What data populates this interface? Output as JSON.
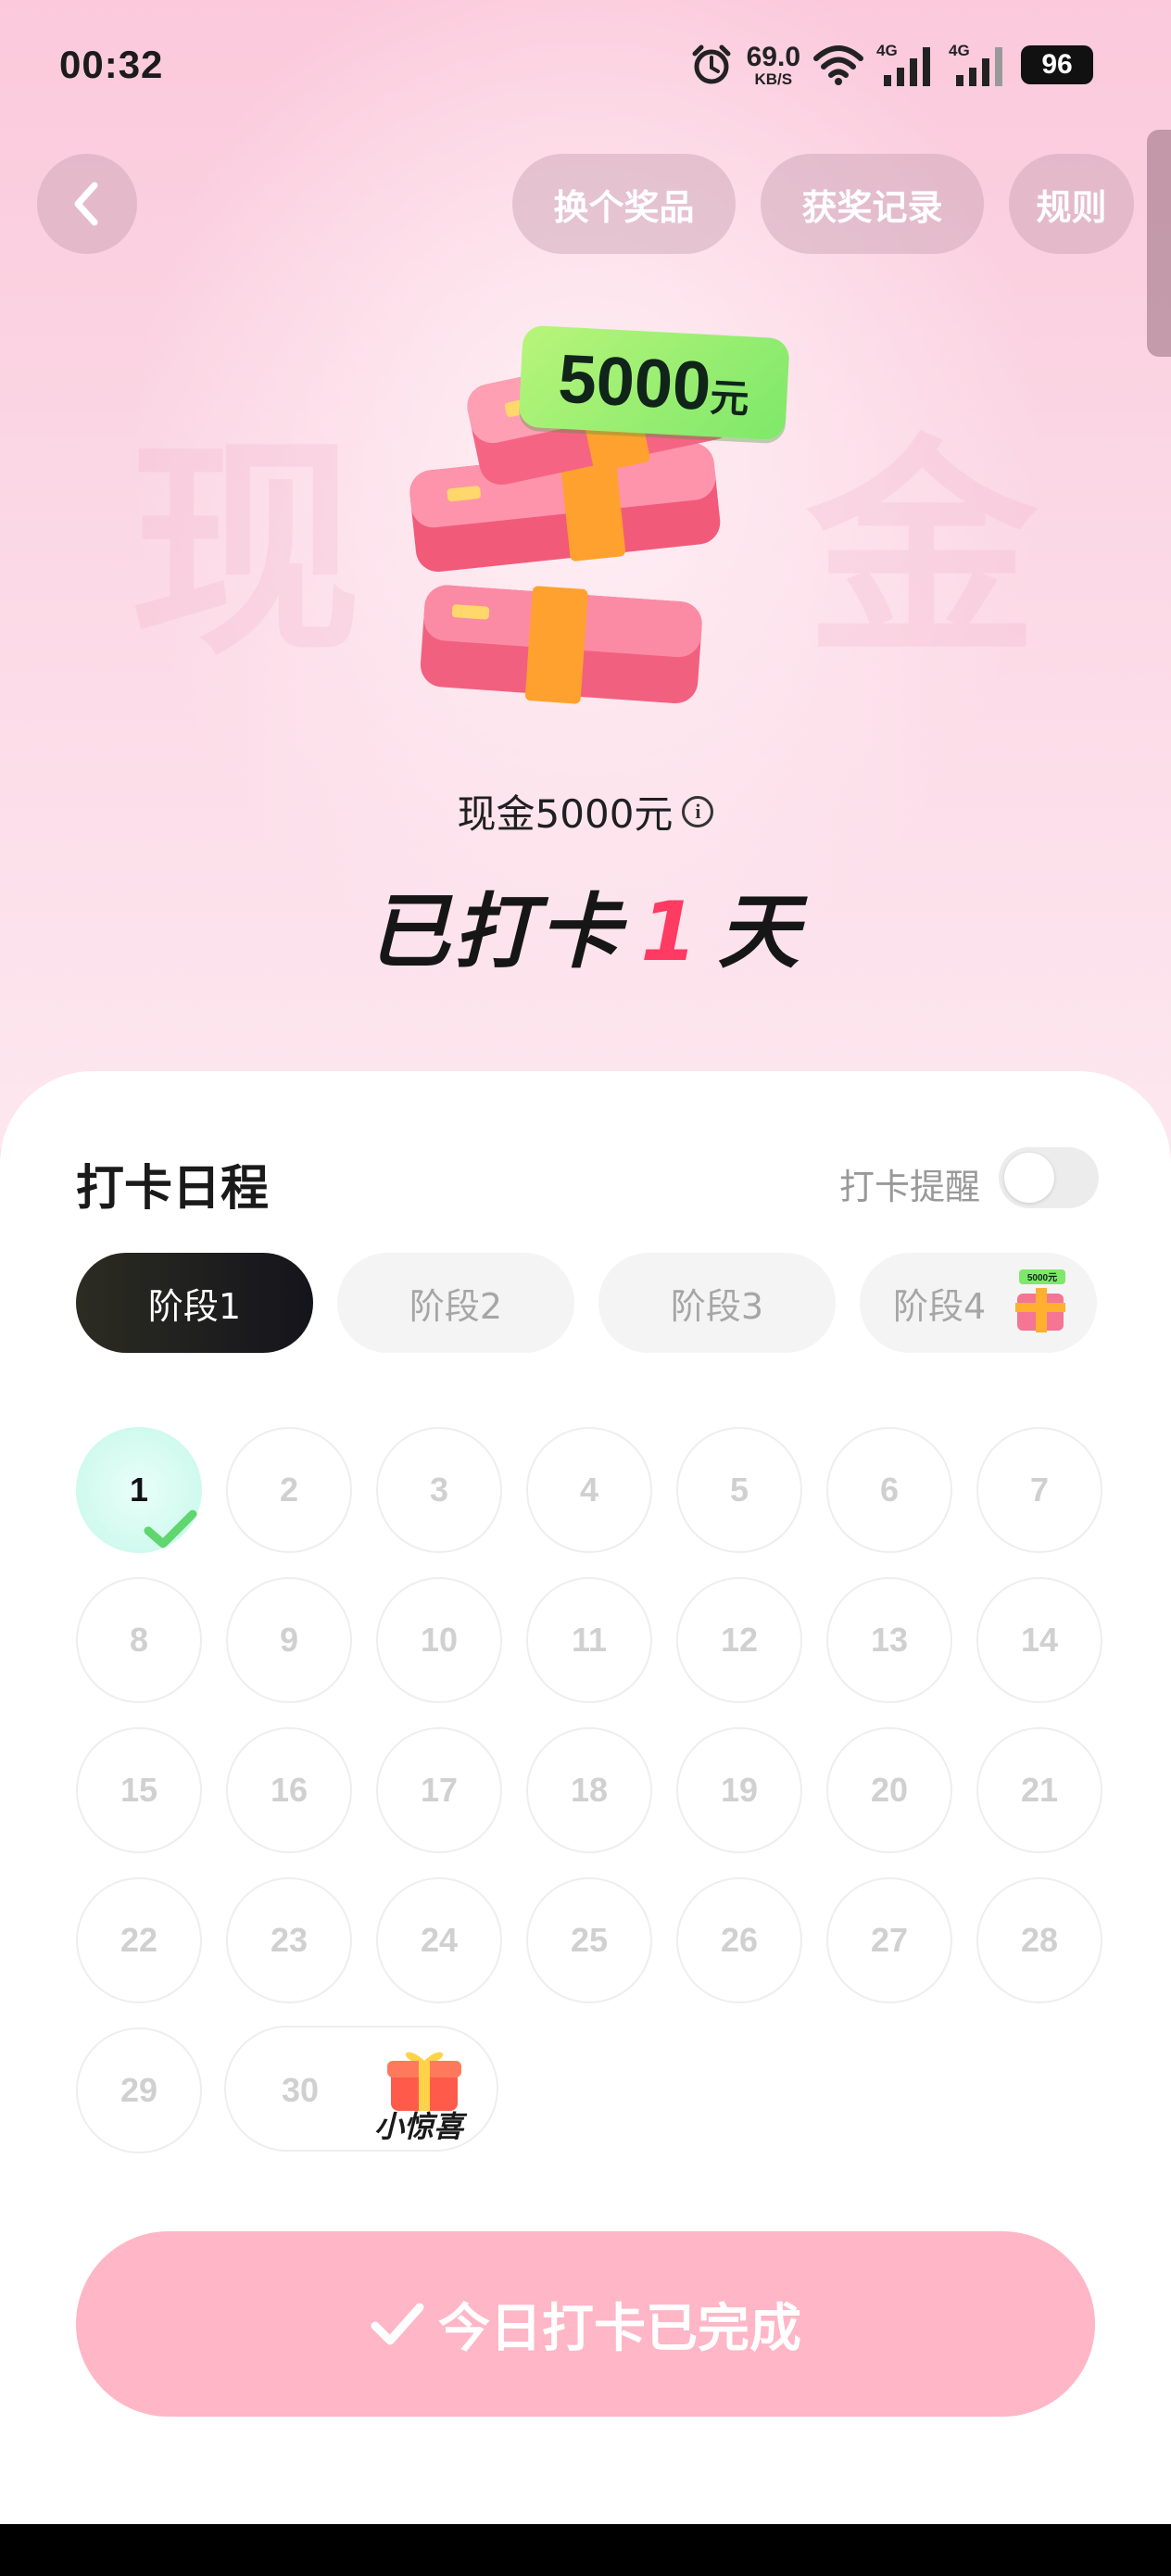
{
  "status_bar": {
    "time": "00:32",
    "net_speed": "69.0",
    "net_unit": "KB/S",
    "signal1": "4G",
    "signal2": "4G",
    "battery": "96"
  },
  "header": {
    "back_icon": "chevron-left-icon",
    "buttons": [
      "换个奖品",
      "获奖记录",
      "规则"
    ]
  },
  "prize": {
    "badge_amount": "5000",
    "badge_unit": "元",
    "watermark_left": "现",
    "watermark_right": "金",
    "name": "现金5000元",
    "info_icon": "info-icon"
  },
  "checkin": {
    "prefix": "已打卡",
    "days": "1",
    "suffix": "天"
  },
  "schedule": {
    "title": "打卡日程",
    "reminder_label": "打卡提醒",
    "reminder_on": false,
    "stages": [
      "阶段1",
      "阶段2",
      "阶段3",
      "阶段4"
    ],
    "stage4_badge": "5000元",
    "active_stage": 0,
    "days": [
      "1",
      "2",
      "3",
      "4",
      "5",
      "6",
      "7",
      "8",
      "9",
      "10",
      "11",
      "12",
      "13",
      "14",
      "15",
      "16",
      "17",
      "18",
      "19",
      "20",
      "21",
      "22",
      "23",
      "24",
      "25",
      "26",
      "27",
      "28",
      "29",
      "30"
    ],
    "completed_days": 1,
    "day30_label": "小惊喜"
  },
  "action": {
    "button_label": "今日打卡已完成",
    "button_icon": "check-icon"
  },
  "colors": {
    "accent": "#ff3a63",
    "button_bg": "#ffb6c6",
    "done_day": "#c6f7ea",
    "check": "#5fd66e"
  }
}
